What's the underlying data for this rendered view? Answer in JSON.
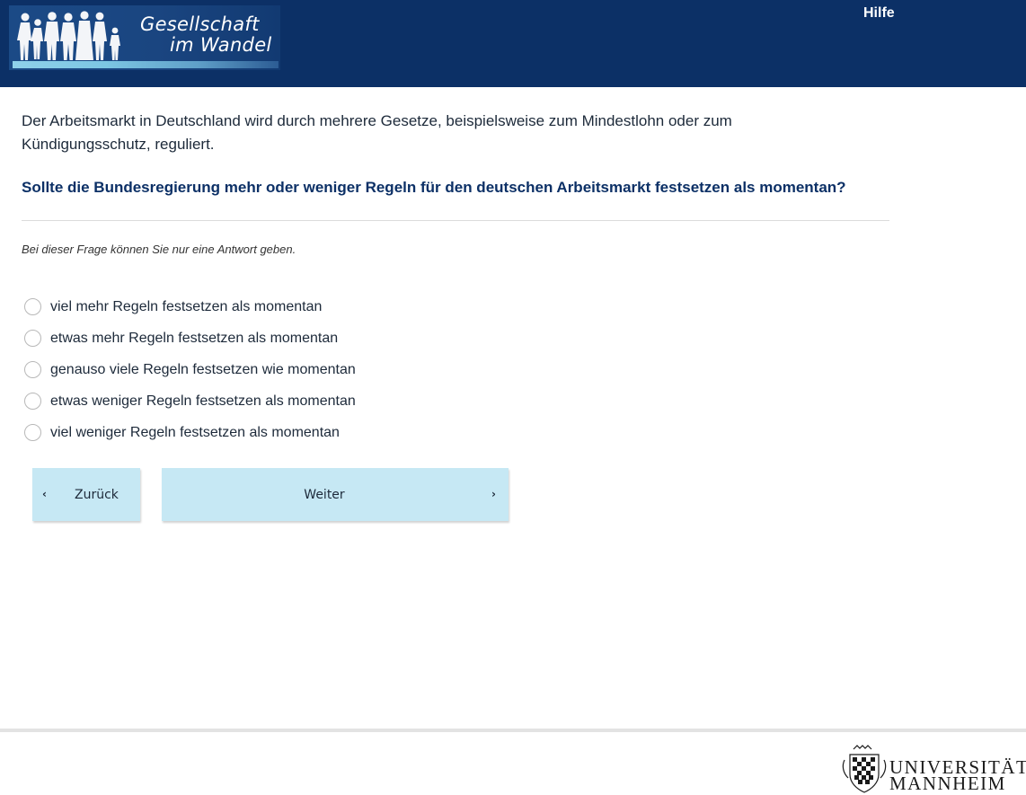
{
  "header": {
    "logo_line1": "Gesellschaft",
    "logo_line2": "im Wandel",
    "help_label": "Hilfe"
  },
  "survey": {
    "intro": "Der Arbeitsmarkt in Deutschland wird durch mehrere Gesetze, beispielsweise zum Mindestlohn oder zum Kündigungsschutz, reguliert.",
    "question": "Sollte die Bundesregierung mehr oder weniger Regeln für den deutschen Arbeitsmarkt festsetzen als momentan?",
    "instruction": "Bei dieser Frage können Sie nur eine Antwort geben.",
    "options": [
      {
        "label": "viel mehr Regeln festsetzen als momentan",
        "selected": false
      },
      {
        "label": "etwas mehr Regeln festsetzen als momentan",
        "selected": false
      },
      {
        "label": "genauso viele Regeln festsetzen wie momentan",
        "selected": false
      },
      {
        "label": "etwas weniger Regeln festsetzen als momentan",
        "selected": false
      },
      {
        "label": "viel weniger Regeln festsetzen als momentan",
        "selected": false
      }
    ]
  },
  "nav": {
    "back_label": "Zurück",
    "next_label": "Weiter",
    "back_icon": "chevron-left-icon",
    "next_icon": "chevron-right-icon"
  },
  "footer": {
    "university_line1": "UNIVERSITÄT",
    "university_line2": "MANNHEIM"
  },
  "colors": {
    "header_bg": "#0c3066",
    "question_text": "#0c3066",
    "button_bg": "#c6e8f4"
  }
}
